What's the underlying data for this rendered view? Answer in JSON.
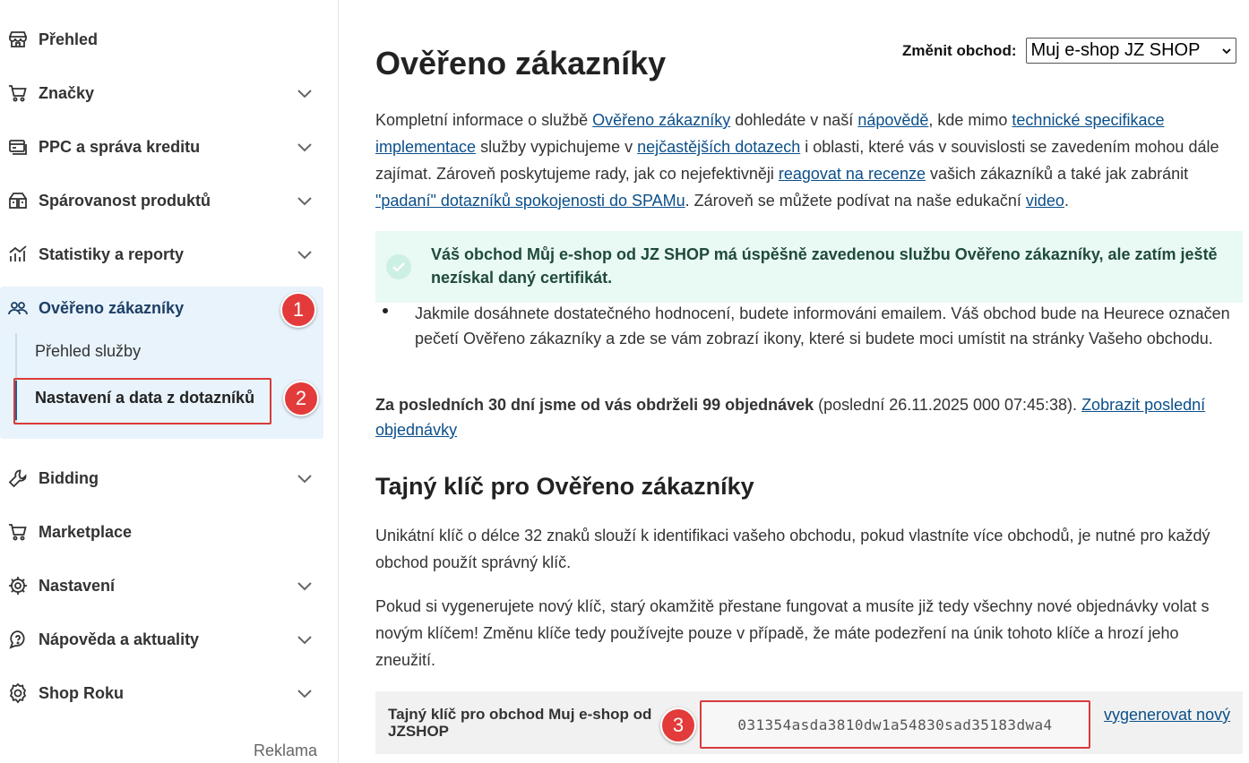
{
  "sidebar": {
    "items": [
      {
        "label": "Přehled",
        "icon": "store-icon",
        "chevron": false
      },
      {
        "label": "Značky",
        "icon": "cart-icon",
        "chevron": true
      },
      {
        "label": "PPC a správa kreditu",
        "icon": "credit-card-icon",
        "chevron": true
      },
      {
        "label": "Spárovanost produktů",
        "icon": "products-icon",
        "chevron": true
      },
      {
        "label": "Statistiky a reporty",
        "icon": "chart-icon",
        "chevron": true
      },
      {
        "label": "Ověřeno zákazníky",
        "icon": "users-icon",
        "chevron": false
      },
      {
        "label": "Bidding",
        "icon": "wrench-icon",
        "chevron": true
      },
      {
        "label": "Marketplace",
        "icon": "cart-icon",
        "chevron": false
      },
      {
        "label": "Nastavení",
        "icon": "gear-icon",
        "chevron": true
      },
      {
        "label": "Nápověda a aktuality",
        "icon": "help-icon",
        "chevron": true
      },
      {
        "label": "Shop Roku",
        "icon": "award-icon",
        "chevron": true
      }
    ],
    "subitems": [
      {
        "label": "Přehled služby"
      },
      {
        "label": "Nastavení a data z dotazníků"
      }
    ],
    "reklama": "Reklama"
  },
  "badges": [
    "1",
    "2",
    "3"
  ],
  "store_switch": {
    "label": "Změnit obchod:",
    "selected": "Muj e-shop JZ SHOP"
  },
  "page": {
    "title": "Ověřeno zákazníky",
    "intro": {
      "t1": "Kompletní informace o službě ",
      "l1": "Ověřeno zákazníky",
      "t2": " dohledáte v naší ",
      "l2": "nápovědě",
      "t3": ", kde mimo ",
      "l3": "technické specifikace implementace",
      "t4": " služby vypichujeme v ",
      "l4": "nejčastějších dotazech",
      "t5": " i oblasti, které vás v souvislosti se zavedením mohou dále zajímat. Zároveň poskytujeme rady, jak co nejefektivněji ",
      "l5": "reagovat na recenze",
      "t6": " vašich zákazníků a také jak zabránit ",
      "l6": "\"padaní\" dotazníků spokojenosti do SPAMu",
      "t7": ". Zároveň se můžete podívat na naše edukační ",
      "l7": "video",
      "t8": "."
    },
    "success_message": "Váš obchod Můj e-shop od JZ SHOP má úspěšně zavedenou službu Ověřeno zákazníky, ale zatím ještě nezískal daný certifikát.",
    "bullet": "Jakmile dosáhnete dostatečného hodnocení, budete informováni emailem. Váš obchod bude na Heurece označen pečetí Ověřeno zákazníky a zde se vám zobrazí ikony, které si budete moci umístit na stránky Vašeho obchodu.",
    "orders": {
      "bold": "Za posledních 30 dní jsme od vás obdrželi 99 objednávek",
      "rest": " (poslední 26.11.2025 000 07:45:38). ",
      "link": "Zobrazit poslední objednávky"
    },
    "secret_heading": "Tajný klíč pro Ověřeno zákazníky",
    "secret_p1": "Unikátní klíč o délce 32 znaků slouží k identifikaci vašeho obchodu, pokud vlastníte více obchodů, je nutné pro každý obchod použít správný klíč.",
    "secret_p2": "Pokud si vygenerujete nový klíč, starý okamžitě přestane fungovat a musíte již tedy všechny nové objednávky volat s novým klíčem! Změnu klíče tedy používejte pouze v případě, že máte podezření na únik tohoto klíče a hrozí jeho zneužití.",
    "key_label": "Tajný klíč pro obchod Muj e-shop od JZSHOP",
    "key_value": "031354asda3810dw1a54830sad35183dwa4",
    "regen_link": "vygenerovat nový"
  },
  "colors": {
    "accent": "#0b4f8a",
    "active_bg": "#e8f3fc",
    "success_bg": "#e9f9f4",
    "annotation": "#e33b3b"
  }
}
